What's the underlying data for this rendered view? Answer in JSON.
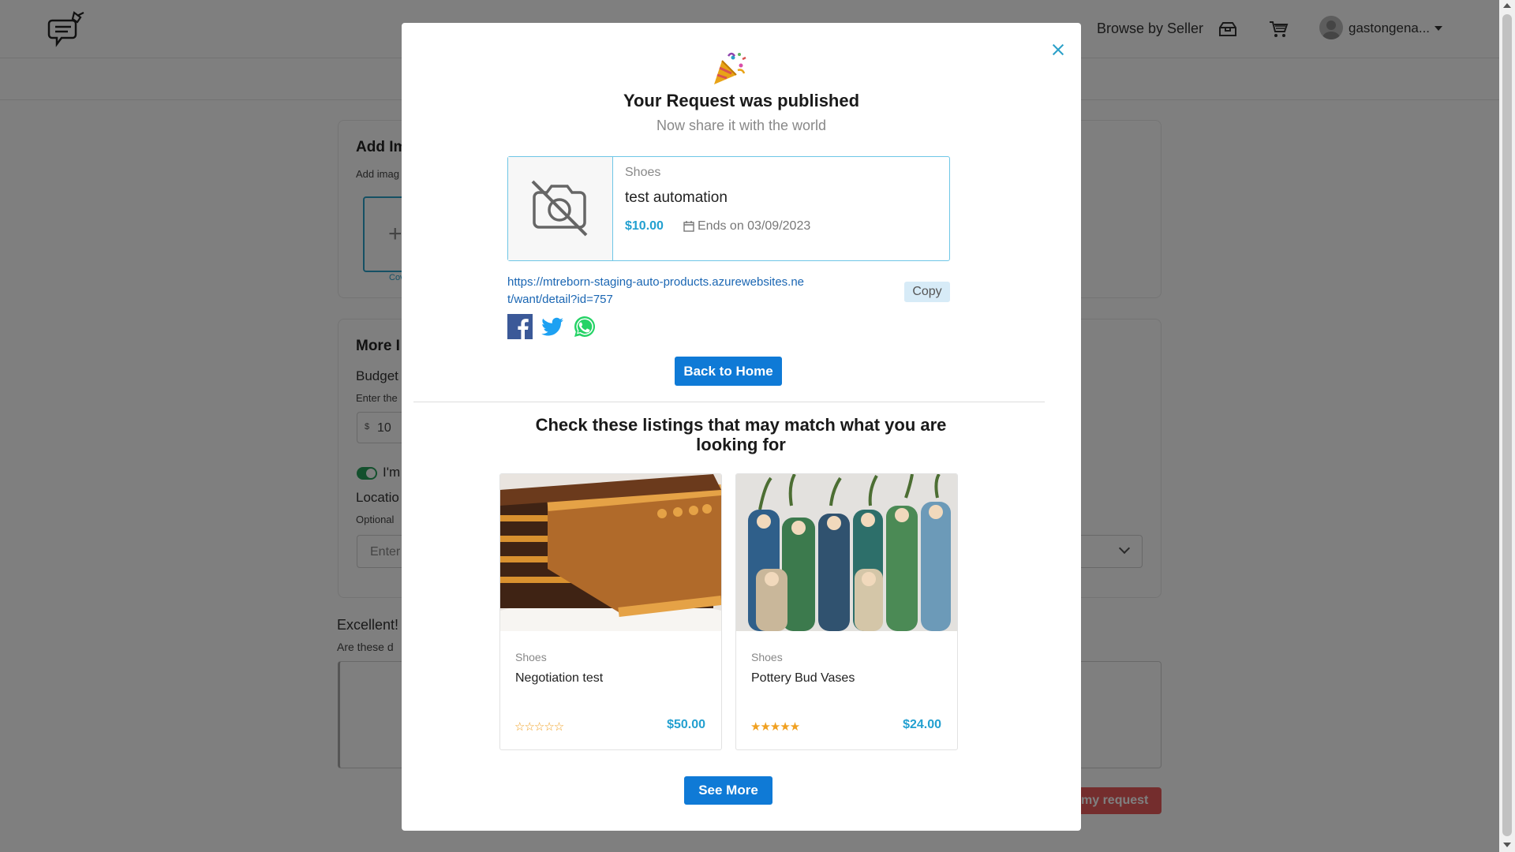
{
  "header": {
    "browse_by_seller": "Browse by Seller",
    "username": "gastongena..."
  },
  "background_form": {
    "add_images_title": "Add Im",
    "add_images_hint": "Add imag",
    "cover_label": "Cov",
    "more_info_title": "More I",
    "budget_label": "Budget",
    "budget_hint": "Enter the",
    "currency": "$",
    "budget_value": "10",
    "toggle_label": "I'm",
    "location_label": "Locatio",
    "optional_label": "Optional",
    "location_placeholder": "Enter",
    "excellent_label": "Excellent!",
    "are_these_label": "Are these d",
    "submit_label": "my request"
  },
  "modal": {
    "title": "Your Request was published",
    "subtitle": "Now share it with the world",
    "request": {
      "category": "Shoes",
      "name": "test automation",
      "price": "$10.00",
      "ends": "Ends on 03/09/2023"
    },
    "share_url": "https://mtreborn-staging-auto-products.azurewebsites.net/want/detail?id=757",
    "copy_label": "Copy",
    "back_home_label": "Back to Home",
    "listings_heading": "Check these listings that may match what you are looking for",
    "listings": [
      {
        "category": "Shoes",
        "name": "Negotiation test",
        "price": "$50.00",
        "rating": 0,
        "stars": "☆☆☆☆☆"
      },
      {
        "category": "Shoes",
        "name": "Pottery Bud Vases",
        "price": "$24.00",
        "rating": 5,
        "stars": "★★★★★"
      }
    ],
    "see_more_label": "See More"
  },
  "colors": {
    "accent": "#0f7ad6",
    "price": "#23a0d0",
    "star": "#f0a020",
    "overlay": "rgba(0,0,0,0.5)"
  },
  "icons": [
    "logo-icon",
    "box-icon",
    "cart-icon",
    "avatar-icon",
    "caret-down-icon",
    "close-icon",
    "party-popper-icon",
    "no-camera-icon",
    "calendar-icon",
    "facebook-icon",
    "twitter-icon",
    "whatsapp-icon"
  ]
}
